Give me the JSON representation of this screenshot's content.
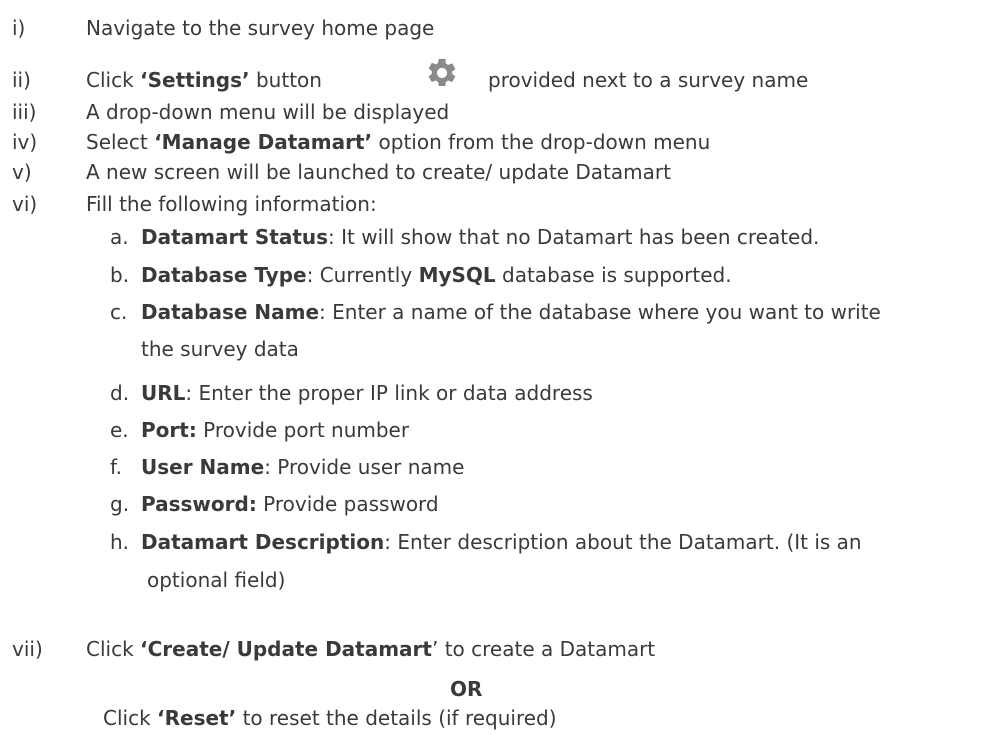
{
  "steps": {
    "s1": {
      "num": "i)",
      "text": "Navigate to the survey home page"
    },
    "s2": {
      "num": "ii)",
      "pre": "Click ",
      "bold": "‘Settings’",
      "mid": " button",
      "post": "provided next to a survey name",
      "icon": "gear-icon"
    },
    "s3": {
      "num": "iii)",
      "text": "A drop-down menu will be displayed"
    },
    "s4": {
      "num": "iv)",
      "pre": "Select ",
      "bold": "‘Manage Datamart’",
      "post": " option from the drop-down menu"
    },
    "s5": {
      "num": "v)",
      "text": "A new screen will be launched to create/ update Datamart"
    },
    "s6": {
      "num": "vi)",
      "text": "Fill the following information:"
    },
    "s7": {
      "num": "vii)",
      "pre": "Click ",
      "bold": "‘Create/ Update Datamart",
      "post": "’ to create a Datamart"
    }
  },
  "fields": {
    "a": {
      "letter": "a.",
      "label": "Datamart Status",
      "text": ": It will show that no Datamart has been created."
    },
    "b": {
      "letter": "b.",
      "label": "Database Type",
      "text1": ": Currently ",
      "bold2": "MySQL",
      "text2": " database is supported."
    },
    "c": {
      "letter": "c.",
      "label": "Database Name",
      "text": ": Enter a name of the database where you want to write",
      "cont": "the survey data"
    },
    "d": {
      "letter": "d.",
      "label": "URL",
      "text": ": Enter the proper IP link or data address"
    },
    "e": {
      "letter": "e.",
      "label": "Port:",
      "text": " Provide port number"
    },
    "f": {
      "letter": "f.",
      "label": "User Name",
      "text": ": Provide user name"
    },
    "g": {
      "letter": "g.",
      "label": "Password:",
      "text": " Provide password"
    },
    "h": {
      "letter": "h.",
      "label": "Datamart Description",
      "text": ": Enter description about the Datamart. (It is an",
      "cont": "optional field)"
    }
  },
  "or_label": "OR",
  "reset": {
    "pre": "Click ",
    "bold": "‘Reset’",
    "post": " to reset the details (if required)"
  },
  "colors": {
    "text": "#3a3a3a",
    "gear": "#8a8a8a"
  }
}
